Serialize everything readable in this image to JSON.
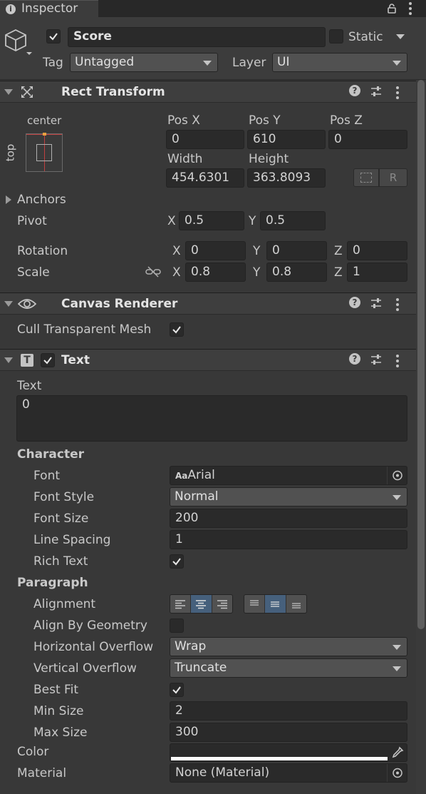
{
  "tab": {
    "title": "Inspector"
  },
  "object": {
    "active": true,
    "name": "Score",
    "static_label": "Static",
    "tag_label": "Tag",
    "tag_value": "Untagged",
    "layer_label": "Layer",
    "layer_value": "UI"
  },
  "rect_transform": {
    "title": "Rect Transform",
    "anchor_h": "center",
    "anchor_v": "top",
    "pos_x_label": "Pos X",
    "pos_x": "0",
    "pos_y_label": "Pos Y",
    "pos_y": "610",
    "pos_z_label": "Pos Z",
    "pos_z": "0",
    "width_label": "Width",
    "width": "454.6301",
    "height_label": "Height",
    "height": "363.8093",
    "r_button": "R",
    "anchors_label": "Anchors",
    "pivot_label": "Pivot",
    "pivot_x_label": "X",
    "pivot_x": "0.5",
    "pivot_y_label": "Y",
    "pivot_y": "0.5",
    "rotation_label": "Rotation",
    "rot_x_label": "X",
    "rot_x": "0",
    "rot_y_label": "Y",
    "rot_y": "0",
    "rot_z_label": "Z",
    "rot_z": "0",
    "scale_label": "Scale",
    "scale_x_label": "X",
    "scale_x": "0.8",
    "scale_y_label": "Y",
    "scale_y": "0.8",
    "scale_z_label": "Z",
    "scale_z": "1"
  },
  "canvas_renderer": {
    "title": "Canvas Renderer",
    "cull_label": "Cull Transparent Mesh",
    "cull_checked": true
  },
  "text_component": {
    "title": "Text",
    "enabled": true,
    "text_label": "Text",
    "text_value": "0",
    "character_label": "Character",
    "font_label": "Font",
    "font_glyph": "Aa",
    "font_value": "Arial",
    "font_style_label": "Font Style",
    "font_style_value": "Normal",
    "font_size_label": "Font Size",
    "font_size_value": "200",
    "line_spacing_label": "Line Spacing",
    "line_spacing_value": "1",
    "rich_text_label": "Rich Text",
    "rich_text": true,
    "paragraph_label": "Paragraph",
    "alignment_label": "Alignment",
    "align_by_geometry_label": "Align By Geometry",
    "align_by_geometry": false,
    "h_overflow_label": "Horizontal Overflow",
    "h_overflow_value": "Wrap",
    "v_overflow_label": "Vertical Overflow",
    "v_overflow_value": "Truncate",
    "best_fit_label": "Best Fit",
    "best_fit": true,
    "min_size_label": "Min Size",
    "min_size_value": "2",
    "max_size_label": "Max Size",
    "max_size_value": "300",
    "color_label": "Color",
    "color_value": "#ffffff",
    "material_label": "Material",
    "material_value": "None (Material)"
  },
  "colors": {
    "panel": "#383838",
    "header": "#3e3e3e",
    "field": "#2a2a2a",
    "selected_segment": "#46607c"
  }
}
